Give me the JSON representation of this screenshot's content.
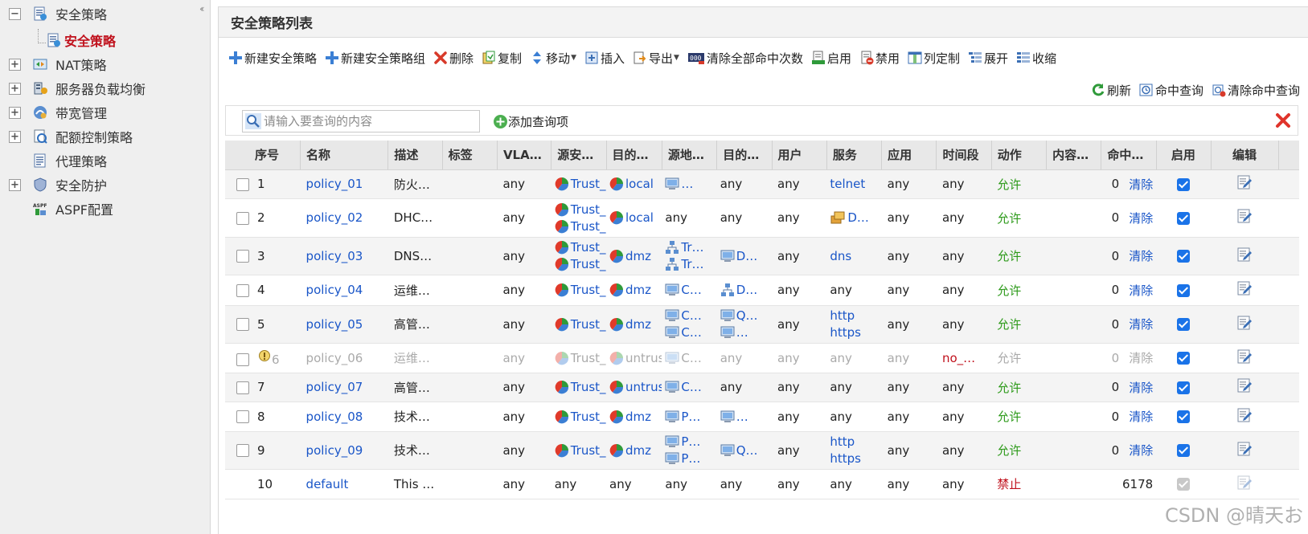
{
  "sidebar": {
    "items": [
      {
        "label": "安全策略",
        "toggle": "−",
        "icon": "policy-doc-icon"
      },
      {
        "label": "安全策略",
        "icon": "policy-doc-icon"
      },
      {
        "label": "NAT策略",
        "toggle": "+",
        "icon": "nat-icon"
      },
      {
        "label": "服务器负载均衡",
        "toggle": "+",
        "icon": "server-lb-icon"
      },
      {
        "label": "带宽管理",
        "toggle": "+",
        "icon": "bandwidth-icon"
      },
      {
        "label": "配额控制策略",
        "toggle": "+",
        "icon": "quota-icon"
      },
      {
        "label": "代理策略",
        "icon": "proxy-doc-icon"
      },
      {
        "label": "安全防护",
        "toggle": "+",
        "icon": "shield-icon"
      },
      {
        "label": "ASPF配置",
        "icon": "aspf-icon"
      }
    ]
  },
  "panel": {
    "title": "安全策略列表"
  },
  "toolbar": {
    "new_policy": "新建安全策略",
    "new_group": "新建安全策略组",
    "delete": "删除",
    "copy": "复制",
    "move": "移动",
    "insert": "插入",
    "export": "导出",
    "clear_all_hits": "清除全部命中次数",
    "enable": "启用",
    "disable": "禁用",
    "columns": "列定制",
    "expand": "展开",
    "collapse": "收缩",
    "refresh": "刷新",
    "hit_query": "命中查询",
    "clear_hit_query": "清除命中查询"
  },
  "search": {
    "placeholder": "请输入要查询的内容",
    "add_query": "添加查询项"
  },
  "columns": [
    "序号",
    "名称",
    "描述",
    "标签",
    "VLA…",
    "源安…",
    "目的…",
    "源地…",
    "目的…",
    "用户",
    "服务",
    "应用",
    "时间段",
    "动作",
    "内容…",
    "命中…",
    "启用",
    "编辑"
  ],
  "rows": [
    {
      "no": "1",
      "name": "policy_01",
      "desc": "防火…",
      "tag": "",
      "vlan": "any",
      "src_zone": [
        "Trust_"
      ],
      "dst_zone": [
        "local"
      ],
      "src_addr": [
        "…"
      ],
      "dst_addr": [
        "any"
      ],
      "user": "any",
      "service": [
        "telnet"
      ],
      "app": "any",
      "time": "any",
      "action": "允许",
      "content": "",
      "hits": "0",
      "clear": "清除",
      "enabled": true
    },
    {
      "no": "2",
      "name": "policy_02",
      "desc": "DHC…",
      "tag": "",
      "vlan": "any",
      "src_zone": [
        "Trust_",
        "Trust_"
      ],
      "dst_zone": [
        "local"
      ],
      "src_addr": [
        "any"
      ],
      "dst_addr": [
        "any"
      ],
      "user": "any",
      "service": [
        "D…"
      ],
      "app": "any",
      "time": "any",
      "action": "允许",
      "content": "",
      "hits": "0",
      "clear": "清除",
      "enabled": true
    },
    {
      "no": "3",
      "name": "policy_03",
      "desc": "DNS…",
      "tag": "",
      "vlan": "any",
      "src_zone": [
        "Trust_",
        "Trust_"
      ],
      "dst_zone": [
        "dmz"
      ],
      "src_addr": [
        "Tr…",
        "Tr…"
      ],
      "dst_addr": [
        "D…"
      ],
      "user": "any",
      "service": [
        "dns"
      ],
      "app": "any",
      "time": "any",
      "action": "允许",
      "content": "",
      "hits": "0",
      "clear": "清除",
      "enabled": true
    },
    {
      "no": "4",
      "name": "policy_04",
      "desc": "运维…",
      "tag": "",
      "vlan": "any",
      "src_zone": [
        "Trust_"
      ],
      "dst_zone": [
        "dmz"
      ],
      "src_addr": [
        "C…"
      ],
      "dst_addr": [
        "D…"
      ],
      "user": "any",
      "service": [
        "any"
      ],
      "app": "any",
      "time": "any",
      "action": "允许",
      "content": "",
      "hits": "0",
      "clear": "清除",
      "enabled": true
    },
    {
      "no": "5",
      "name": "policy_05",
      "desc": "高管…",
      "tag": "",
      "vlan": "any",
      "src_zone": [
        "Trust_"
      ],
      "dst_zone": [
        "dmz"
      ],
      "src_addr": [
        "C…",
        "C…"
      ],
      "dst_addr": [
        "Q…",
        "…"
      ],
      "user": "any",
      "service": [
        "http",
        "https"
      ],
      "app": "any",
      "time": "any",
      "action": "允许",
      "content": "",
      "hits": "0",
      "clear": "清除",
      "enabled": true
    },
    {
      "no": "6",
      "name": "policy_06",
      "desc": "运维…",
      "tag": "",
      "vlan": "any",
      "src_zone": [
        "Trust_"
      ],
      "dst_zone": [
        "untrus"
      ],
      "src_addr": [
        "C…"
      ],
      "dst_addr": [
        "any"
      ],
      "user": "any",
      "service": [
        "any"
      ],
      "app": "any",
      "time": "no_…",
      "action": "允许",
      "content": "",
      "hits": "0",
      "clear": "清除",
      "enabled": true
    },
    {
      "no": "7",
      "name": "policy_07",
      "desc": "高管…",
      "tag": "",
      "vlan": "any",
      "src_zone": [
        "Trust_"
      ],
      "dst_zone": [
        "untrus"
      ],
      "src_addr": [
        "C…"
      ],
      "dst_addr": [
        "any"
      ],
      "user": "any",
      "service": [
        "any"
      ],
      "app": "any",
      "time": "any",
      "action": "允许",
      "content": "",
      "hits": "0",
      "clear": "清除",
      "enabled": true
    },
    {
      "no": "8",
      "name": "policy_08",
      "desc": "技术…",
      "tag": "",
      "vlan": "any",
      "src_zone": [
        "Trust_"
      ],
      "dst_zone": [
        "dmz"
      ],
      "src_addr": [
        "P…"
      ],
      "dst_addr": [
        "…"
      ],
      "user": "any",
      "service": [
        "any"
      ],
      "app": "any",
      "time": "any",
      "action": "允许",
      "content": "",
      "hits": "0",
      "clear": "清除",
      "enabled": true
    },
    {
      "no": "9",
      "name": "policy_09",
      "desc": "技术…",
      "tag": "",
      "vlan": "any",
      "src_zone": [
        "Trust_"
      ],
      "dst_zone": [
        "dmz"
      ],
      "src_addr": [
        "P…",
        "P…"
      ],
      "dst_addr": [
        "Q…"
      ],
      "user": "any",
      "service": [
        "http",
        "https"
      ],
      "app": "any",
      "time": "any",
      "action": "允许",
      "content": "",
      "hits": "0",
      "clear": "清除",
      "enabled": true
    },
    {
      "no": "10",
      "name": "default",
      "desc": "This …",
      "tag": "",
      "vlan": "any",
      "src_zone": [
        "any"
      ],
      "dst_zone": [
        "any"
      ],
      "src_addr": [
        "any"
      ],
      "dst_addr": [
        "any"
      ],
      "user": "any",
      "service": [
        "any"
      ],
      "app": "any",
      "time": "any",
      "action": "禁止",
      "content": "",
      "hits": "6178",
      "clear": "",
      "enabled": true
    }
  ],
  "watermark": "CSDN @晴天お",
  "colors": {
    "link": "#1a56c8",
    "allow": "#2d9a1a",
    "deny": "#c0111c",
    "checkbox": "#1a73e8"
  }
}
